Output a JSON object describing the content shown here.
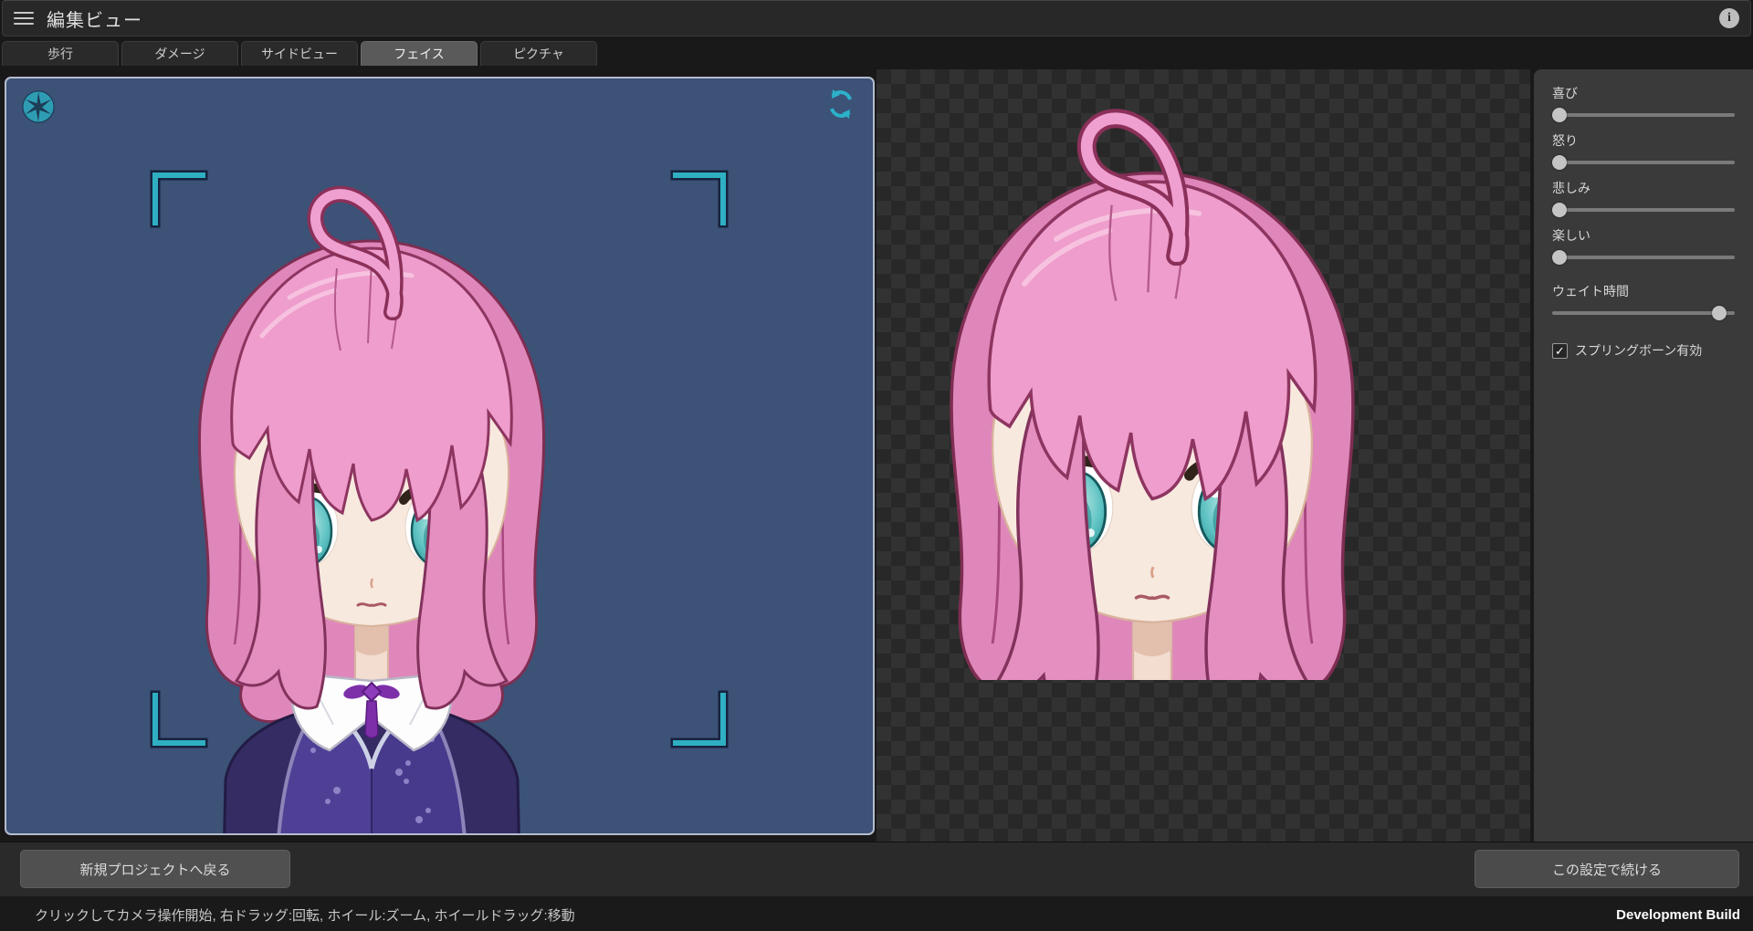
{
  "header": {
    "title": "編集ビュー",
    "menu_icon": "hamburger-icon",
    "info_icon": "info-icon"
  },
  "tabs": {
    "active_index": 3,
    "items": [
      {
        "label": "歩行"
      },
      {
        "label": "ダメージ"
      },
      {
        "label": "サイドビュー"
      },
      {
        "label": "フェイス"
      },
      {
        "label": "ピクチャ"
      }
    ]
  },
  "viewport": {
    "camera_icon": "aperture-icon",
    "reset_icon": "refresh-icon",
    "background_color": "#3c5277",
    "accent_color": "#2cb0c4",
    "frame_bracket_color": "#2fb0c2"
  },
  "character": {
    "description": "pink-haired chibi anime girl, teal eyes, white collar, purple kimono",
    "hair_color": "#ec9ccb",
    "eye_color": "#5fc3c3",
    "skin_color": "#f8e9df",
    "outfit_color": "#4b3d97"
  },
  "sidebar": {
    "sliders": [
      {
        "label": "喜び",
        "value": 0
      },
      {
        "label": "怒り",
        "value": 0
      },
      {
        "label": "悲しみ",
        "value": 0
      },
      {
        "label": "楽しい",
        "value": 0
      },
      {
        "label": "ウェイト時間",
        "value": 0.95
      }
    ],
    "checkbox": {
      "label": "スプリングボーン有効",
      "checked": true,
      "check_glyph": "✓"
    }
  },
  "footer": {
    "back_button": "新規プロジェクトへ戻る",
    "continue_button": "この設定で続ける"
  },
  "status_bar": {
    "hint": "クリックしてカメラ操作開始, 右ドラッグ:回転, ホイール:ズーム, ホイールドラッグ:移動",
    "build_label": "Development Build"
  }
}
